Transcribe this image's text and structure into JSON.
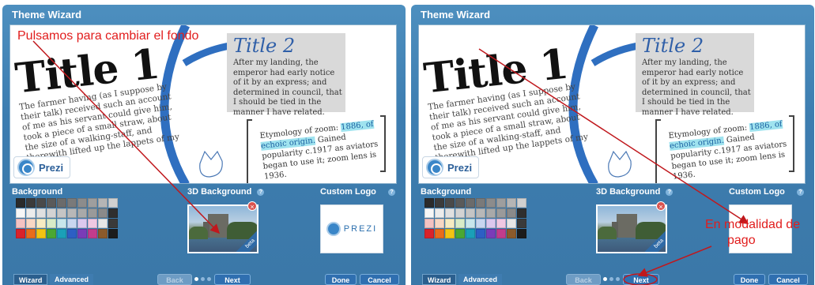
{
  "panels": [
    {
      "title": "Theme Wizard",
      "slide": {
        "title1": "Title 1",
        "body1": "The farmer having (as I suppose by their talk) received such an account of me as his servant could give him, took a piece of a small straw, about the size of a walking-staff, and therewith lifted up the lappets of my coat;",
        "title2": "Title 2",
        "body2": "After my landing, the emperor had early notice of it by an express; and determined in council, that I should be tied in the manner I have related.",
        "etym_before": "Etymology of zoom:",
        "etym_highlight": "1886, of echoic origin.",
        "etym_after": "Gained popularity c.1917 as aviators began to use it; zoom lens is 1936.",
        "badge_label": "Prezi"
      },
      "sections": {
        "background": "Background",
        "background_3d": "3D Background",
        "custom_logo": "Custom Logo",
        "help": "?"
      },
      "bg3d_beta": "beta",
      "remove_badge": "×",
      "custom_logo_wordmark": "PREZI",
      "tabs": {
        "wizard": "Wizard",
        "advanced": "Advanced"
      },
      "buttons": {
        "back": "Back",
        "next": "Next",
        "done": "Done",
        "cancel": "Cancel"
      },
      "annotation": "Pulsamos para cambiar el fondo"
    },
    {
      "title": "Theme Wizard",
      "slide": {
        "title1": "Title 1",
        "body1": "The farmer having (as I suppose by their talk) received such an account of me as his servant could give him, took a piece of a small straw, about the size of a walking-staff, and therewith lifted up the lappets of my coat;",
        "title2": "Title 2",
        "body2": "After my landing, the emperor had early notice of it by an express; and determined in council, that I should be tied in the manner I have related.",
        "etym_before": "Etymology of zoom:",
        "etym_highlight": "1886, of echoic origin.",
        "etym_after": "Gained popularity c.1917 as aviators began to use it; zoom lens is 1936.",
        "badge_label": "Prezi"
      },
      "sections": {
        "background": "Background",
        "background_3d": "3D Background",
        "custom_logo": "Custom Logo",
        "help": "?"
      },
      "bg3d_beta": "beta",
      "remove_badge": "×",
      "tabs": {
        "wizard": "Wizard",
        "advanced": "Advanced"
      },
      "buttons": {
        "back": "Back",
        "next": "Next",
        "done": "Done",
        "cancel": "Cancel"
      },
      "annotation_line1": "En modalidad de",
      "annotation_line2": "pago"
    }
  ],
  "swatch_colors": [
    "#2b2b2b",
    "#3b3b3b",
    "#4a4a4a",
    "#5a5a5a",
    "#6b6b6b",
    "#7a7a7a",
    "#8c8c8c",
    "#9e9e9e",
    "#b5b5b5",
    "#d0d0d0",
    "#f7f7f7",
    "#ececec",
    "#e0e0e0",
    "#d3d3d3",
    "#c5c5c5",
    "#b8b8b8",
    "#a9a9a9",
    "#9a9a9a",
    "#8a8a8a",
    "#2f2f2f",
    "#f4c2c2",
    "#f7d7c4",
    "#f6ecc2",
    "#d8ecc8",
    "#c8e6ec",
    "#c8d6f0",
    "#dcc8ee",
    "#f0c8e2",
    "#e6e6e6",
    "#3a3a3a",
    "#d9222b",
    "#e86c1c",
    "#f2c413",
    "#4aa832",
    "#1aa0b8",
    "#2d5fc4",
    "#7a3cb8",
    "#c23c8c",
    "#8b5a2b",
    "#1c1c1c"
  ],
  "colors": {
    "panel": "#3d7db0",
    "annotation_red": "#e11d1d",
    "arrow_blue": "#2f6fc0"
  }
}
